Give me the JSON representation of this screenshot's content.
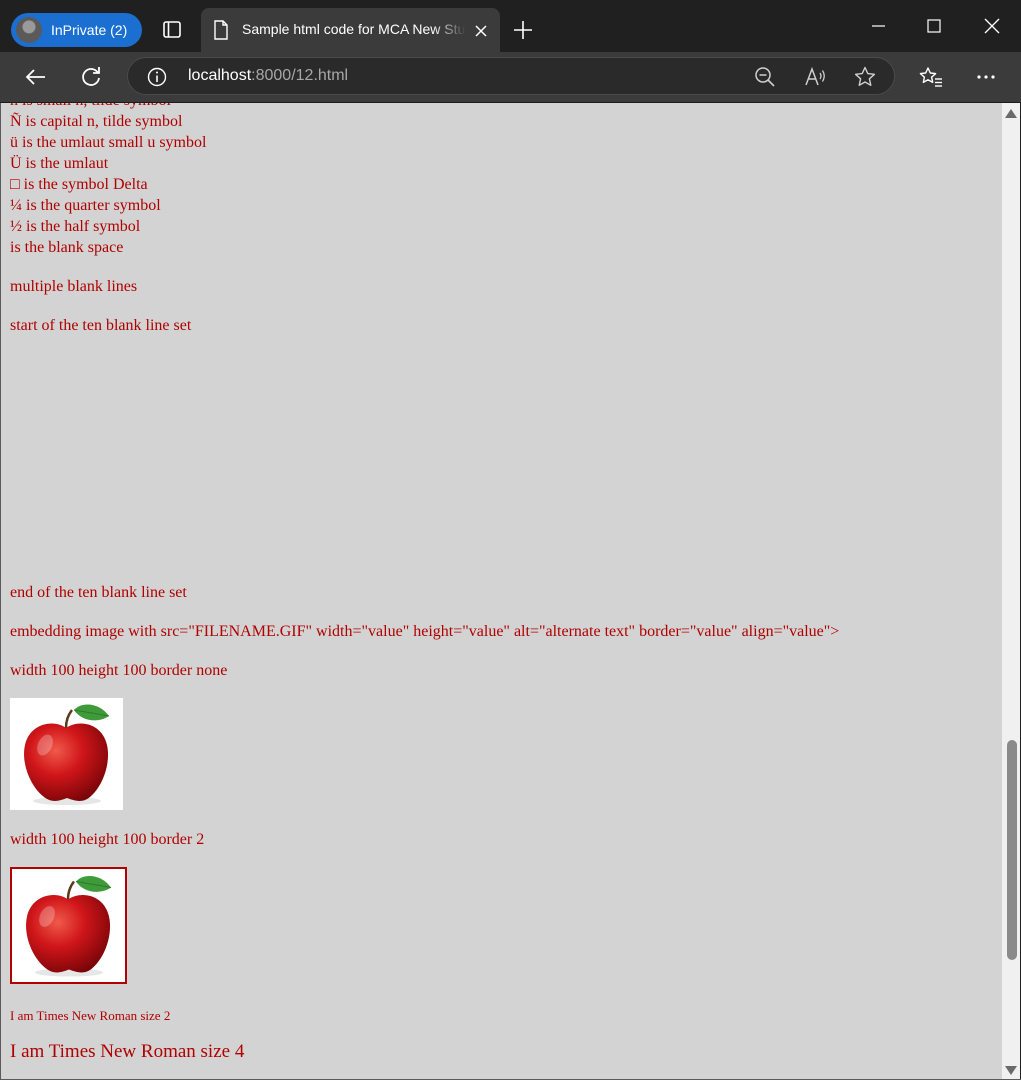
{
  "browser": {
    "profile_label": "InPrivate (2)",
    "tab_title": "Sample html code for MCA New Students",
    "url_host": "localhost",
    "url_path": ":8000/12.html"
  },
  "page": {
    "lines_top": [
      "ñ is small n, tilde symbol",
      "Ñ is capital n, tilde symbol",
      "ü is the umlaut small u symbol",
      "Ü is the umlaut",
      "□ is the symbol Delta",
      "¼ is the quarter symbol",
      "½ is the half symbol",
      " is the blank space"
    ],
    "multiple_blank": "multiple blank lines",
    "start_set": "start of the ten blank line set",
    "end_set": "end of the ten blank line set",
    "embedding": "embedding image with src=\"FILENAME.GIF\" width=\"value\" height=\"value\" alt=\"alternate text\" border=\"value\" align=\"value\">",
    "img1_caption": "width 100 height 100 border none",
    "img2_caption": "width 100 height 100 border 2",
    "font_small": "I am Times New Roman size 2",
    "font_large": "I am Times New Roman size 4",
    "image_subject": "apple",
    "text_color": "#b00000",
    "page_background": "#d3d3d3"
  }
}
